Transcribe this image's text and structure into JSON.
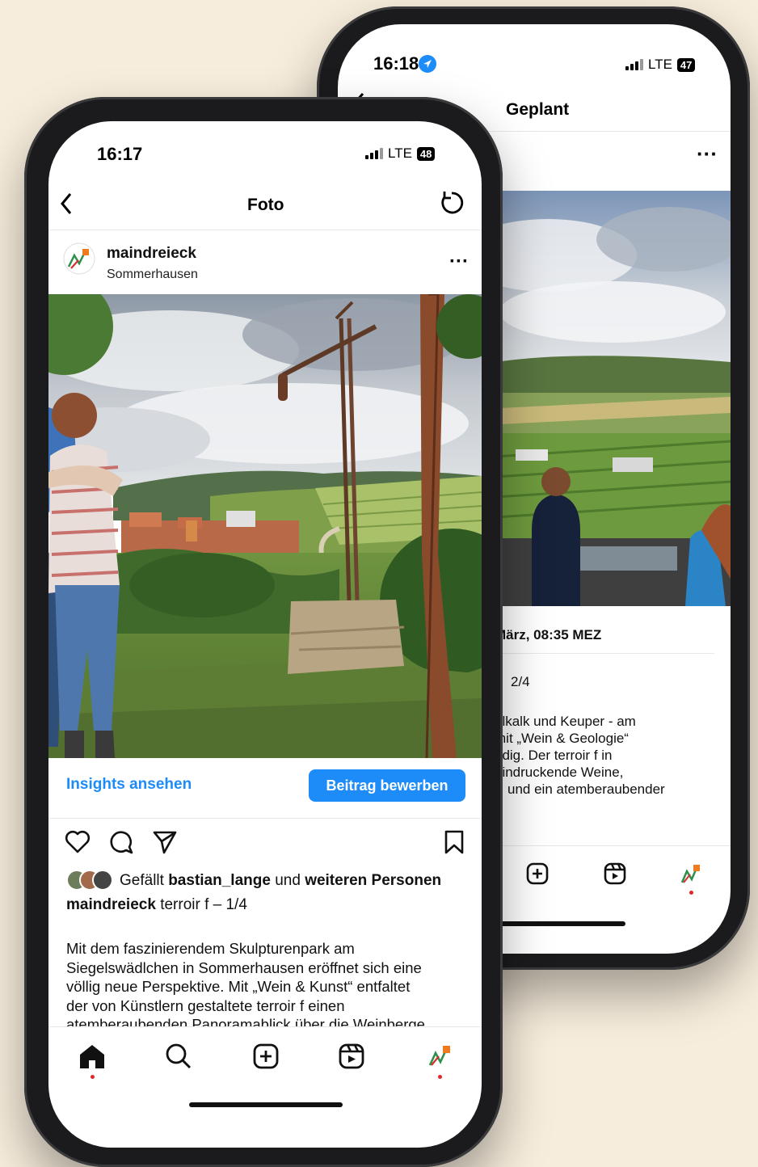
{
  "back_phone": {
    "status": {
      "time": "16:18",
      "network": "LTE",
      "battery": "47"
    },
    "header": {
      "title": "Geplant"
    },
    "more_label": "···",
    "timestamp": "März, 08:35 MEZ",
    "page_counter": "2/4",
    "caption_lines": [
      "elkalk und Keuper - am",
      "mit „Wein & Geologie“",
      "ndig. Der terroir f in",
      "eindruckende Weine,",
      "und ein atemberaubender"
    ]
  },
  "front_phone": {
    "status": {
      "time": "16:17",
      "network": "LTE",
      "battery": "48"
    },
    "header": {
      "title": "Foto"
    },
    "post": {
      "username": "maindreieck",
      "location": "Sommerhausen",
      "more_label": "···",
      "insights_label": "Insights ansehen",
      "promote_label": "Beitrag bewerben",
      "likes_prefix": "Gefällt",
      "likes_user": "bastian_lange",
      "likes_middle": "und",
      "likes_suffix": "weiteren Personen",
      "caption_user": "maindreieck",
      "caption_short": "terroir f – 1/4",
      "caption_lines": [
        "Mit dem faszinierendem Skulpturenpark am",
        "Siegelswädlchen in Sommerhausen eröffnet sich eine",
        "völlig neue Perspektive. Mit „Wein & Kunst“ entfaltet",
        "der von Künstlern gestaltete terroir f einen",
        "atemberaubenden Panoramablick über die Weinberge"
      ]
    }
  },
  "colors": {
    "background": "#f7eddc",
    "accent": "#1d8cf8",
    "notification_dot": "#e0282a"
  },
  "icons": {
    "nav": [
      "home-icon",
      "search-icon",
      "create-icon",
      "reels-icon",
      "profile-icon"
    ],
    "actions": [
      "heart-icon",
      "comment-icon",
      "share-icon",
      "bookmark-icon"
    ]
  }
}
